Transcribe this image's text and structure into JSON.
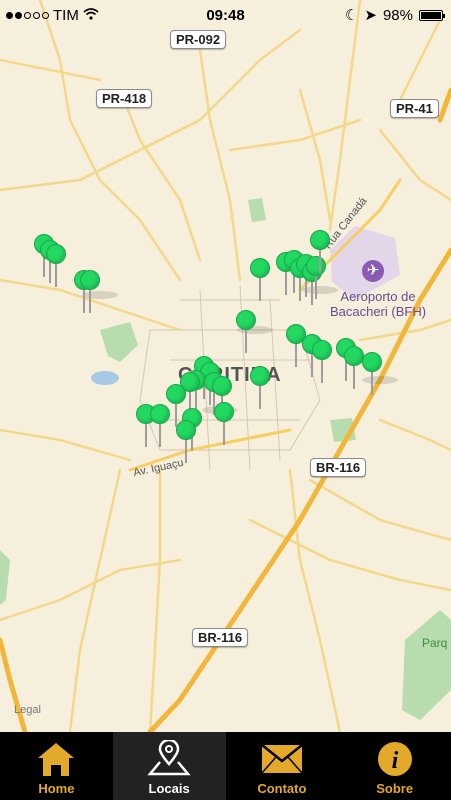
{
  "status": {
    "carrier": "TIM",
    "time": "09:48",
    "battery": "98%"
  },
  "map": {
    "roads": [
      "PR-092",
      "PR-418",
      "PR-41",
      "BR-116",
      "BR-116"
    ],
    "airport": "Aeroporto de Bacacheri (BFH)",
    "city": "CURITIBA",
    "streets": [
      "Rua Canadá",
      "Av. Iguaçu"
    ],
    "park": "Parq",
    "legal": "Legal",
    "pin_color": "#22d861"
  },
  "tabs": [
    {
      "label": "Home",
      "icon": "home-icon"
    },
    {
      "label": "Locais",
      "icon": "map-pin-icon"
    },
    {
      "label": "Contato",
      "icon": "envelope-icon"
    },
    {
      "label": "Sobre",
      "icon": "info-icon"
    }
  ],
  "active_tab": "Locais"
}
